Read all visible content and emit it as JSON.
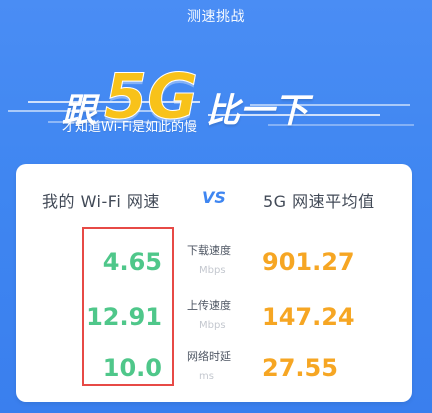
{
  "app": {
    "title": "测速挑战"
  },
  "hero": {
    "prefix": "跟",
    "brand": "5G",
    "suffix": "比一下",
    "subtitle": "才知道Wi-Fi是如此的慢"
  },
  "comparison": {
    "left_title": "我的 Wi-Fi 网速",
    "vs": "VS",
    "right_title": "5G 网速平均值",
    "rows": [
      {
        "label": "下载速度",
        "unit": "Mbps",
        "left": "4.65",
        "right": "901.27"
      },
      {
        "label": "上传速度",
        "unit": "Mbps",
        "left": "12.91",
        "right": "147.24"
      },
      {
        "label": "网络时延",
        "unit": "ms",
        "left": "10.0",
        "right": "27.55"
      }
    ]
  },
  "colors": {
    "background": "#3f86f1",
    "highlight": "#e74a46",
    "wifi_value": "#4fc78a",
    "fiveg_value": "#f6a623",
    "brand": "#f8c21a"
  }
}
